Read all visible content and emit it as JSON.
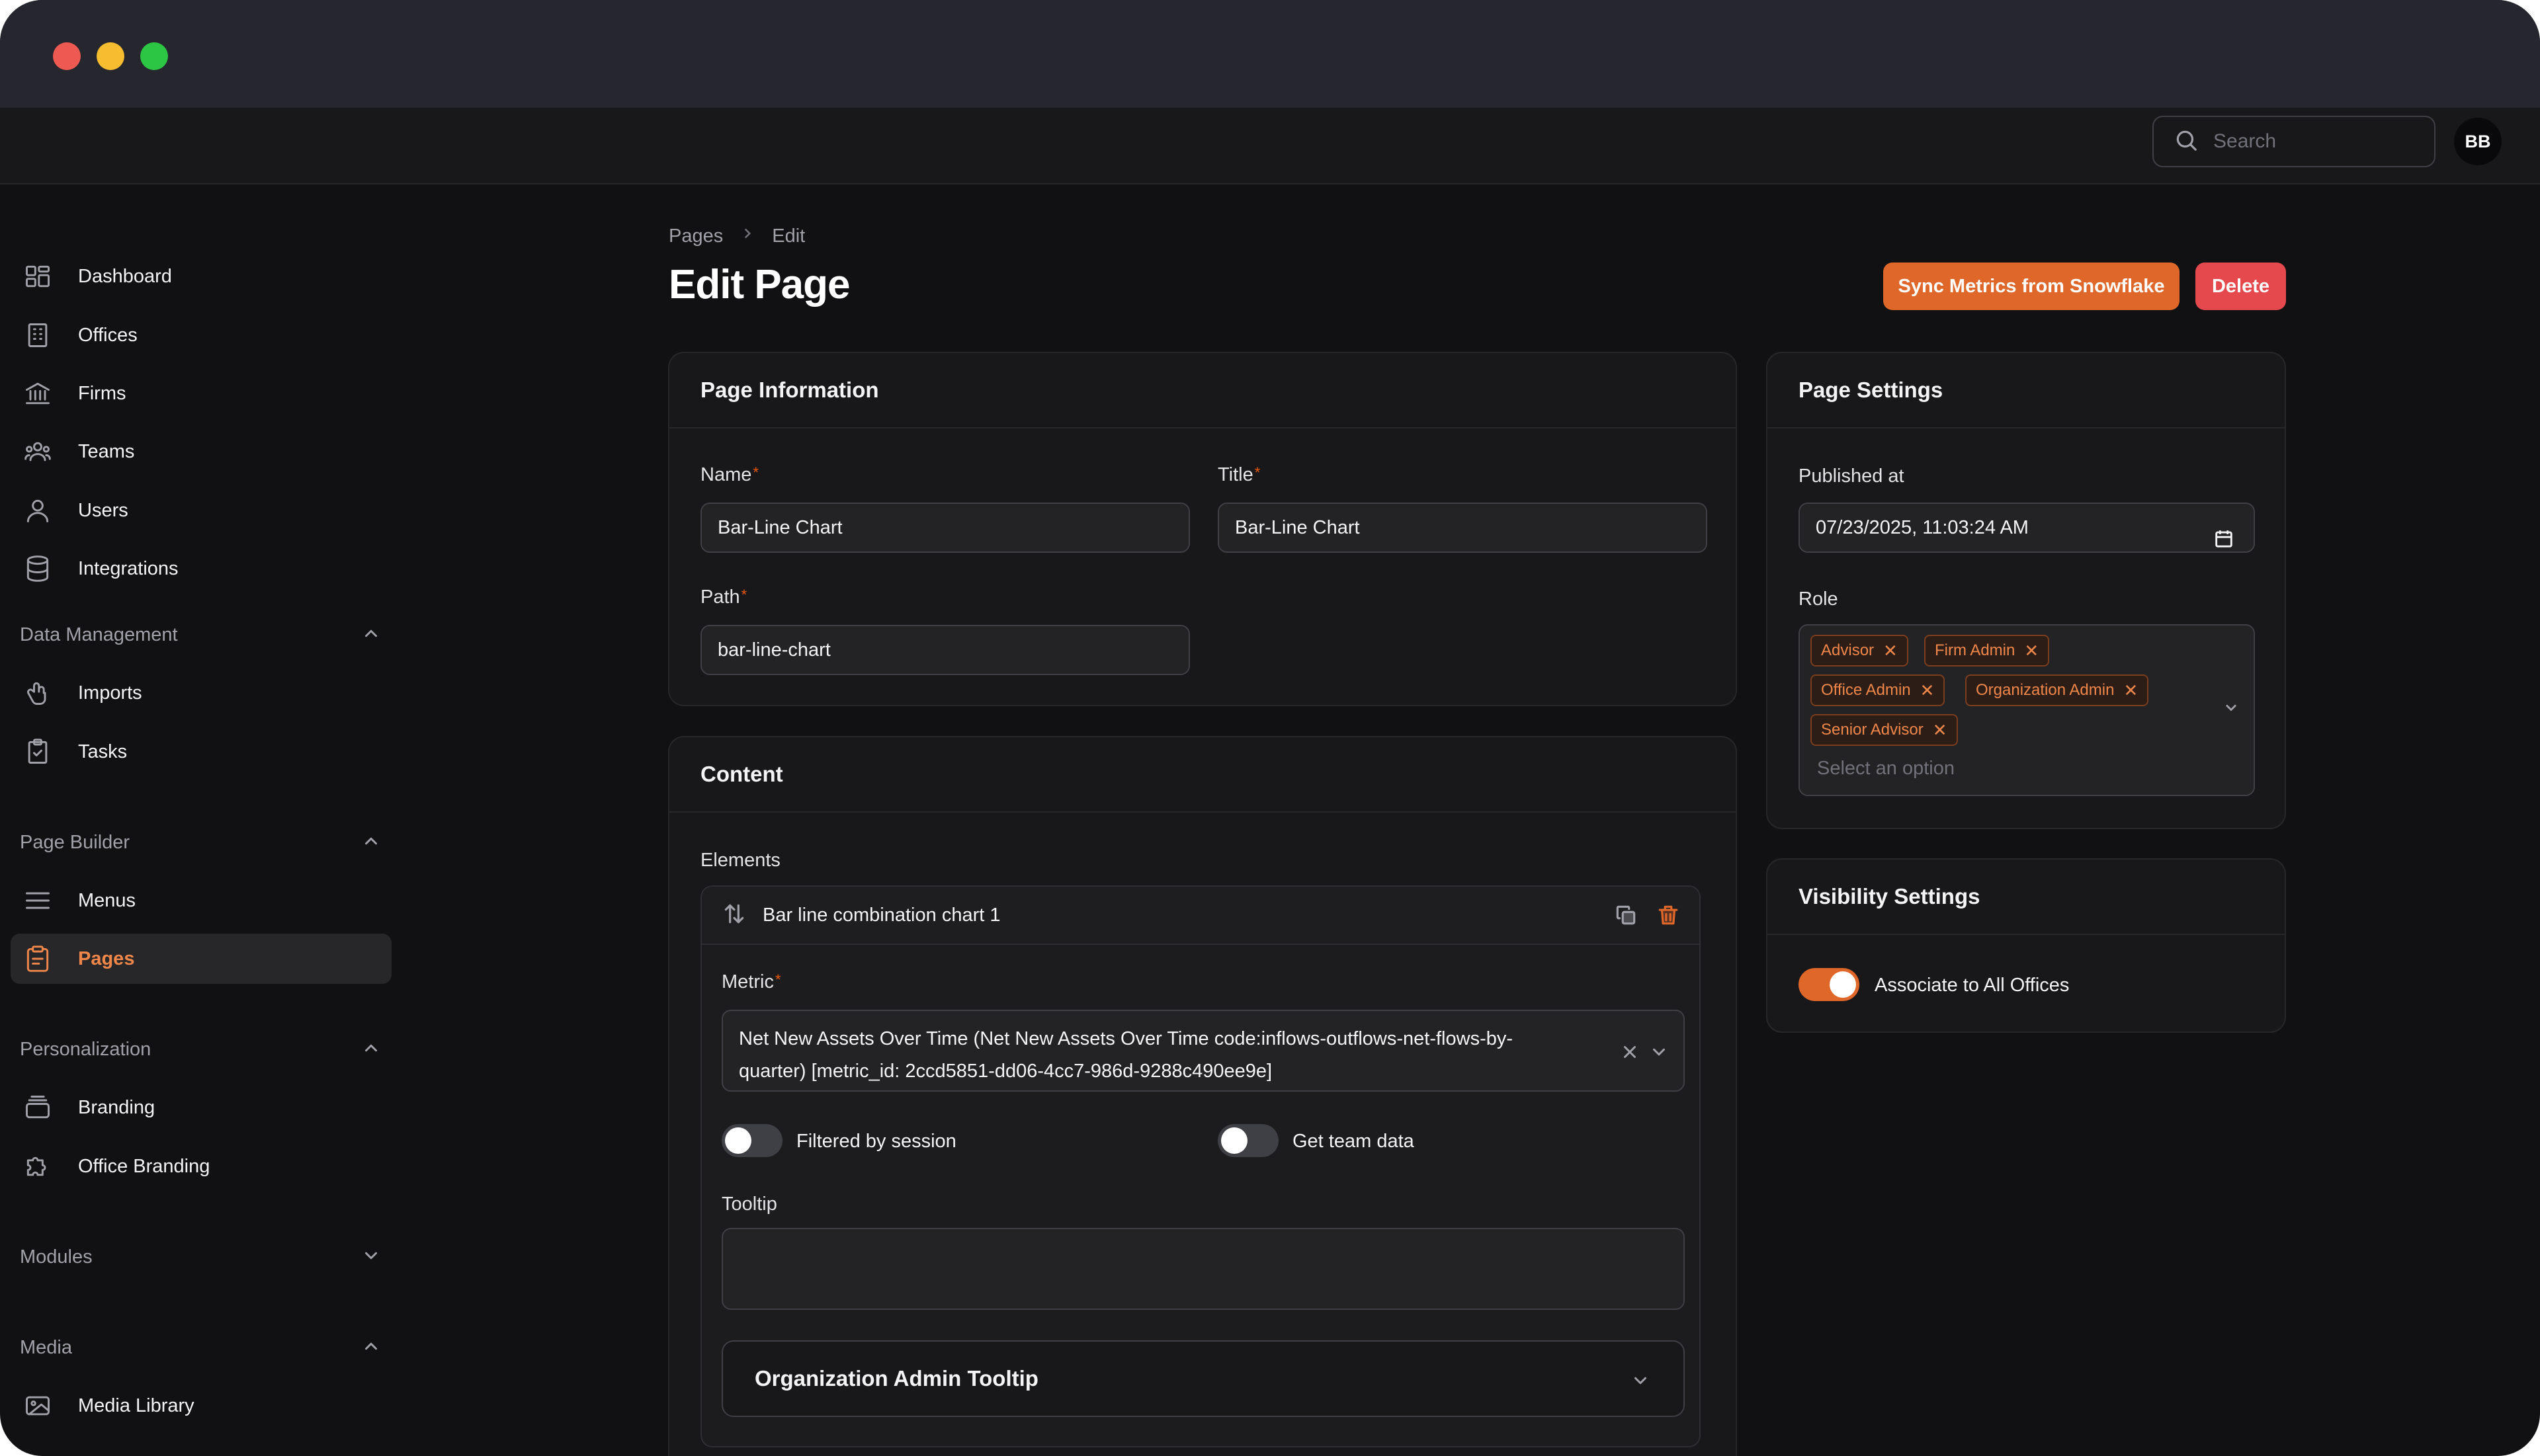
{
  "topbar": {
    "search_placeholder": "Search",
    "avatar_initials": "BB"
  },
  "sidebar": {
    "primary_items": [
      {
        "label": "Dashboard",
        "icon": "dashboard-icon"
      },
      {
        "label": "Offices",
        "icon": "building-icon"
      },
      {
        "label": "Firms",
        "icon": "bank-icon"
      },
      {
        "label": "Teams",
        "icon": "users-group-icon"
      },
      {
        "label": "Users",
        "icon": "user-icon"
      },
      {
        "label": "Integrations",
        "icon": "database-icon"
      }
    ],
    "groups": {
      "data_management": {
        "label": "Data Management",
        "expanded": true,
        "items": [
          {
            "label": "Imports",
            "icon": "import-icon"
          },
          {
            "label": "Tasks",
            "icon": "clipboard-check-icon"
          }
        ]
      },
      "page_builder": {
        "label": "Page Builder",
        "expanded": true,
        "items": [
          {
            "label": "Menus",
            "icon": "menu-icon"
          },
          {
            "label": "Pages",
            "icon": "clipboard-pages-icon",
            "active": true
          }
        ]
      },
      "personalization": {
        "label": "Personalization",
        "expanded": true,
        "items": [
          {
            "label": "Branding",
            "icon": "stack-icon"
          },
          {
            "label": "Office Branding",
            "icon": "puzzle-icon"
          }
        ]
      },
      "modules": {
        "label": "Modules",
        "expanded": false
      },
      "media": {
        "label": "Media",
        "expanded": true,
        "items": [
          {
            "label": "Media Library",
            "icon": "image-icon"
          }
        ]
      }
    }
  },
  "header": {
    "breadcrumb": [
      "Pages",
      "Edit"
    ],
    "title": "Edit Page",
    "sync_button": "Sync Metrics from Snowflake",
    "delete_button": "Delete"
  },
  "page_information": {
    "heading": "Page Information",
    "name_label": "Name",
    "name_value": "Bar-Line Chart",
    "title_label": "Title",
    "title_value": "Bar-Line Chart",
    "path_label": "Path",
    "path_value": "bar-line-chart",
    "required_mark": "*"
  },
  "content": {
    "heading": "Content",
    "elements_label": "Elements",
    "element": {
      "title": "Bar line combination chart 1",
      "metric_label": "Metric",
      "metric_line1": "Net New Assets Over Time (Net New Assets Over Time code:inflows-outflows-net-flows-by-",
      "metric_line2": "quarter) [metric_id: 2ccd5851-dd06-4cc7-986d-9288c490ee9e]",
      "filtered_by_session_label": "Filtered by session",
      "filtered_by_session": false,
      "get_team_data_label": "Get team data",
      "get_team_data": false,
      "tooltip_label": "Tooltip",
      "tooltip_value": "",
      "org_admin_tooltip": "Organization Admin Tooltip"
    }
  },
  "page_settings": {
    "heading": "Page Settings",
    "published_at_label": "Published at",
    "published_at_value": "07/23/2025, 11:03:24 AM",
    "role_label": "Role",
    "roles": [
      "Advisor",
      "Firm Admin",
      "Office Admin",
      "Organization Admin",
      "Senior Advisor"
    ],
    "role_placeholder": "Select an option"
  },
  "visibility_settings": {
    "heading": "Visibility Settings",
    "associate_label": "Associate to All Offices",
    "associate_enabled": true
  },
  "colors": {
    "accent": "#e0672a",
    "danger": "#e5484d",
    "background": "#111113",
    "card": "#18181b"
  }
}
